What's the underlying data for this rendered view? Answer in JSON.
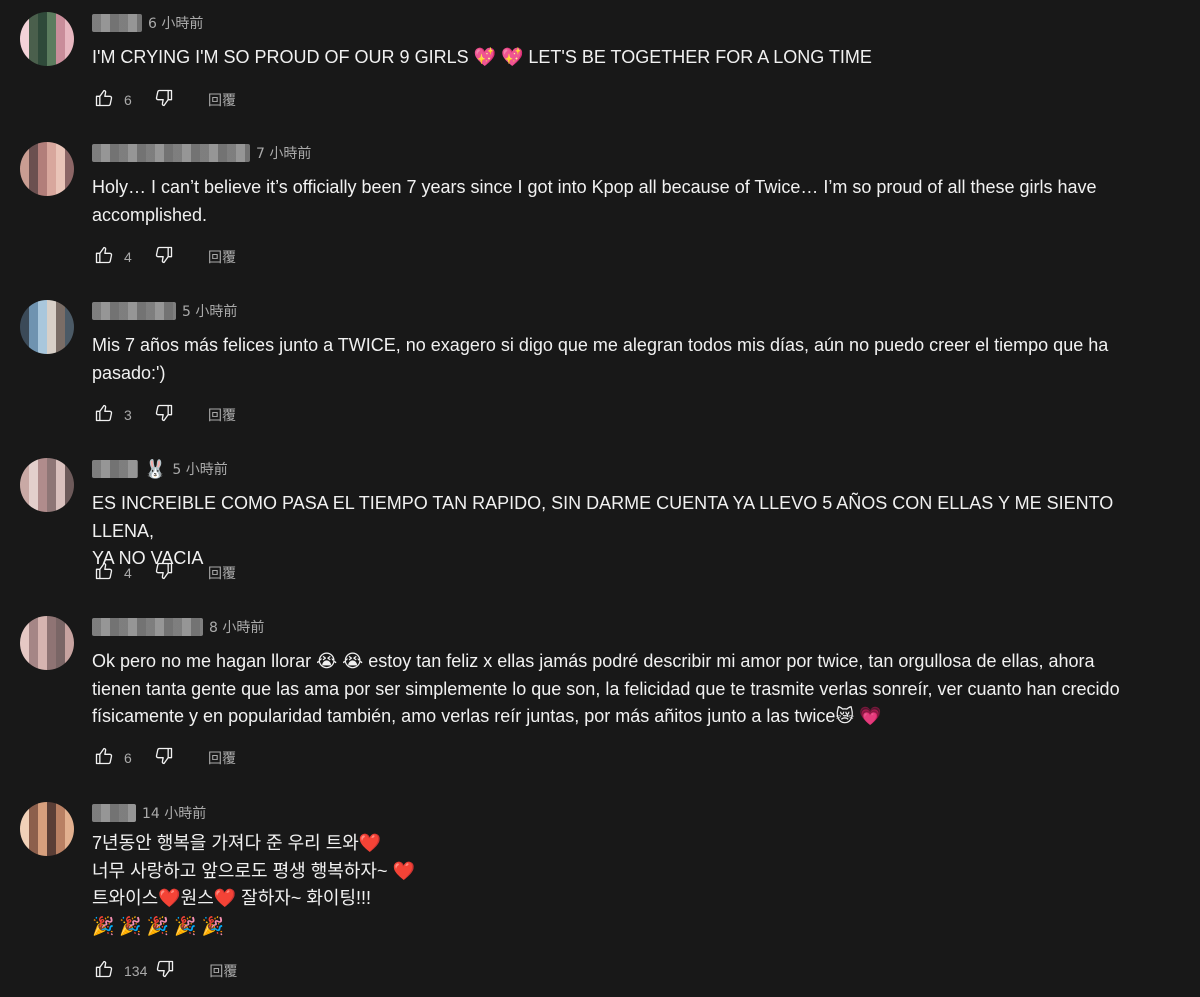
{
  "reply_label": "回覆",
  "comments": [
    {
      "time": "6 小時前",
      "text": "I'M CRYING I'M SO PROUD OF OUR 9 GIRLS 💖 💖  LET'S BE TOGETHER FOR A LONG TIME",
      "likes": "6",
      "badge": ""
    },
    {
      "time": "7 小時前",
      "text": "Holy… I can’t believe it’s officially been 7 years since I got into Kpop all because of Twice… I’m so proud of all these girls have\naccomplished.",
      "likes": "4",
      "badge": ""
    },
    {
      "time": "5 小時前",
      "text": "Mis 7 años más felices junto a TWICE, no exagero si digo que me alegran todos mis días, aún no puedo creer el tiempo que ha\npasado:')",
      "likes": "3",
      "badge": ""
    },
    {
      "time": "5 小時前",
      "text": "ES INCREIBLE COMO PASA EL TIEMPO TAN RAPIDO, SIN DARME CUENTA YA LLEVO 5 AÑOS CON ELLAS Y ME SIENTO LLENA,\nYA NO VACIA",
      "likes": "4",
      "badge": "🐰"
    },
    {
      "time": "8 小時前",
      "text": "Ok pero no me hagan llorar 😭 😭  estoy tan feliz x ellas jamás podré describir mi amor por twice, tan orgullosa de ellas, ahora\ntienen tanta gente que las ama por ser simplemente lo que son, la felicidad que te trasmite verlas sonreír, ver cuanto han crecido\nfísicamente y en popularidad también, amo verlas reír juntas, por más añitos junto a las twice😿 💗",
      "likes": "6",
      "badge": ""
    },
    {
      "time": "14 小時前",
      "text": "7년동안 행복을 가져다 준 우리 트와❤️\n너무 사랑하고 앞으로도 평생 행복하자~ ❤️\n트와이스❤️원스❤️ 잘하자~ 화이팅!!!\n🎉 🎉 🎉 🎉 🎉",
      "likes": "134",
      "badge": ""
    }
  ]
}
